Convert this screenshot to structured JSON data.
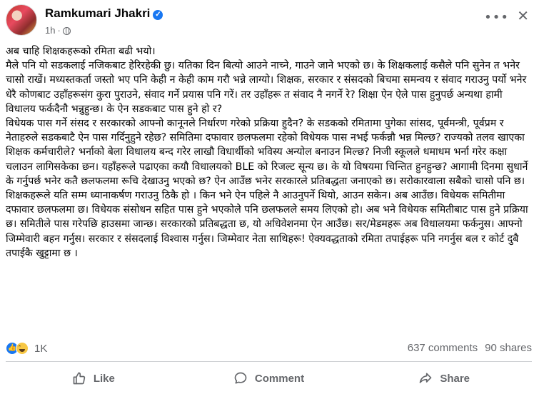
{
  "post": {
    "author": "Ramkumari Jhakri",
    "time": "1h",
    "paragraphs": [
      "अब चाहि शिक्षकहरूको रमिता बढी भयो।",
      "मैले पनि यो सडकलाई नजिकबाट हेरिरहेकी छु। यतिका दिन बित्यो आउने नाच्ने, गाउने जाने भएको छ। के शिक्षकलाई कसैले पनि सुनेन त भनेर चासो राखें। मध्यस्तकर्ता जस्तो भए पनि केही न केही काम गरौ भन्ने लाग्यो। शिक्षक, सरकार र संसदको बिचमा समन्वय र संवाद गराउनु पर्यो भनेर धेरै कोणबाट उहाँहरूसंग कुरा पुराउने, संवाद गर्ने प्रयास पनि गरें। तर उहाँहरू त संवाद नै नगर्ने रे? शिक्षा ऐन ऐले पास हुनुपर्छ अन्यथा हामी विधालय फर्कदैनौ भन्नुहुन्छ। के ऐन सडकबाट पास हुने हो र?",
      "विधेयक पास गर्ने संसद र सरकारको आफ्नो कानूनले निर्धारण गरेको प्रक्रिया हुदैन? के सडकको रमितामा पुगेका सांसद, पूर्वमन्त्री, पूर्वप्रम र नेताहरुले सडकबाटै ऐन पास गर्दिनुहुने रहेछ? समितिमा दफावार छलफलमा रहेको विधेयक पास नभई फर्कन्नौ भन्न मिल्छ? राज्यको तलव खाएका शिक्षक कर्मचारीले? भर्नाको बेला विधालय बन्द गरेर लाखौ विधार्थीको भविस्य अन्योल बनाउन मिल्छ? निजी स्कूलले धमाधम भर्ना गरेर कक्षा चलाउन लागिसकेका छन। यहाँहरूले पढाएका कयौ विधालयको BLE को रिजल्ट सून्य छ। के यो विषयमा चिन्तित हुनहुन्छ? आगामी दिनमा सुधार्ने के गर्नुपर्छ भनेर कतै छलफलमा रूचि देखाउनु भएको छ? ऐन आउँछ भनेर सरकारले प्रतिबद्धता जनाएको छ। सरोकारवाला सबैको चासो पनि छ।शिक्षकहरूले यति सम्म ध्यानाकर्षण गराउनु ठिकै हो । किन भने ऐन पहिले नै आउनुपर्ने थियो, आउन सकेन। अब आउँछ। विधेयक समितीमा दफावार छलफलमा छ। विधेयक संसोधन सहित पास हुने भएकोले पनि छलफलले समय लिएको हो। अब भने विधेयक समितीबाट पास हुने प्रक्रिया छ। समितीले पास गरेपछि हाउसमा जान्छ। सरकारको प्रतिबद्धता छ, यो अधिवेशनमा ऐन आउँछ। सर/मेडमहरू अब विधालयमा फर्कनुस। आफ्नो जिम्मेवारी बहन गर्नुस। सरकार र संसदलाई विश्वास गर्नुस। जिम्मेवार नेता साथिहरू! ऐक्यवद्धताको रमिता तपाईहरू पनि नगर्नुस बल र कोर्ट दुबै तपाईकै खुट्टामा छ ।"
    ]
  },
  "stats": {
    "reactions_count": "1K",
    "comments": "637 comments",
    "shares": "90 shares"
  },
  "actions": {
    "like": "Like",
    "comment": "Comment",
    "share": "Share"
  },
  "icons": [
    "verified-icon",
    "globe-icon",
    "more-icon",
    "close-icon",
    "like-icon",
    "haha-icon",
    "thumb-up-icon",
    "comment-icon",
    "share-icon"
  ],
  "colors": {
    "accent": "#1877f2",
    "secondary_text": "#65676b",
    "divider": "#ced0d4"
  }
}
